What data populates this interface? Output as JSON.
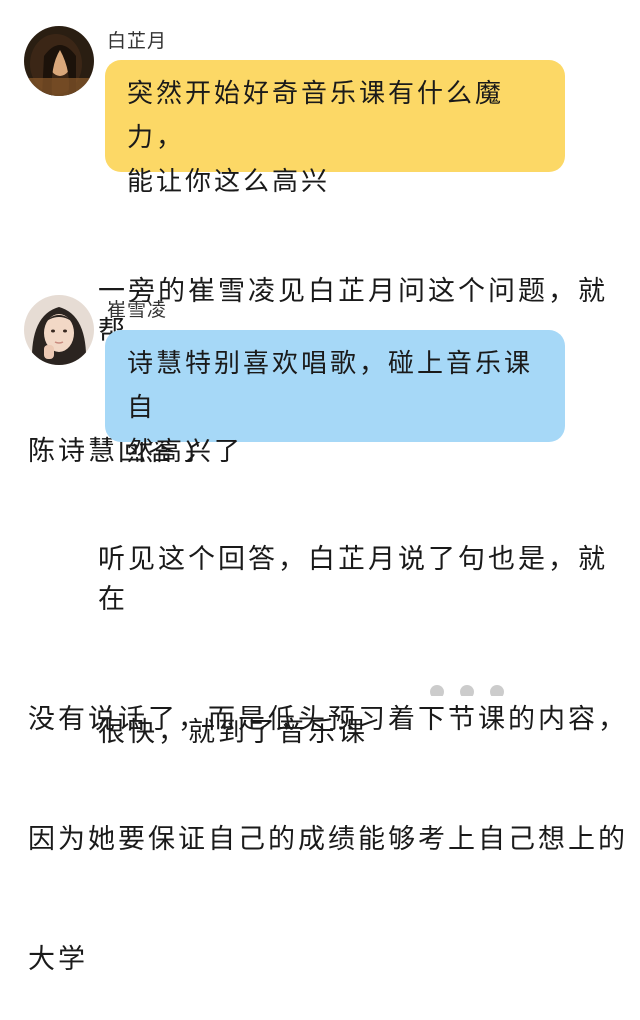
{
  "messages": [
    {
      "speaker": "白芷月",
      "avatar": "avatar-girl-dark-hair-icon",
      "bubble_color": "#fcd866",
      "lines": [
        "突然开始好奇音乐课有什么魔力，",
        "能让你这么高兴"
      ]
    },
    {
      "speaker": "崔雪凌",
      "avatar": "avatar-girl-portrait-icon",
      "bubble_color": "#a6d8f7",
      "lines": [
        "诗慧特别喜欢唱歌，碰上音乐课自",
        "然高兴了"
      ]
    }
  ],
  "narration": [
    [
      "一旁的崔雪凌见白芷月问这个问题，就帮",
      "陈诗慧回答了"
    ],
    [
      "听见这个回答，白芷月说了句也是，就在",
      "没有说话了，而是低头预习着下节课的内容，",
      "因为她要保证自己的成绩能够考上自己想上的",
      "大学"
    ],
    [
      "很快，就到了音乐课"
    ]
  ]
}
